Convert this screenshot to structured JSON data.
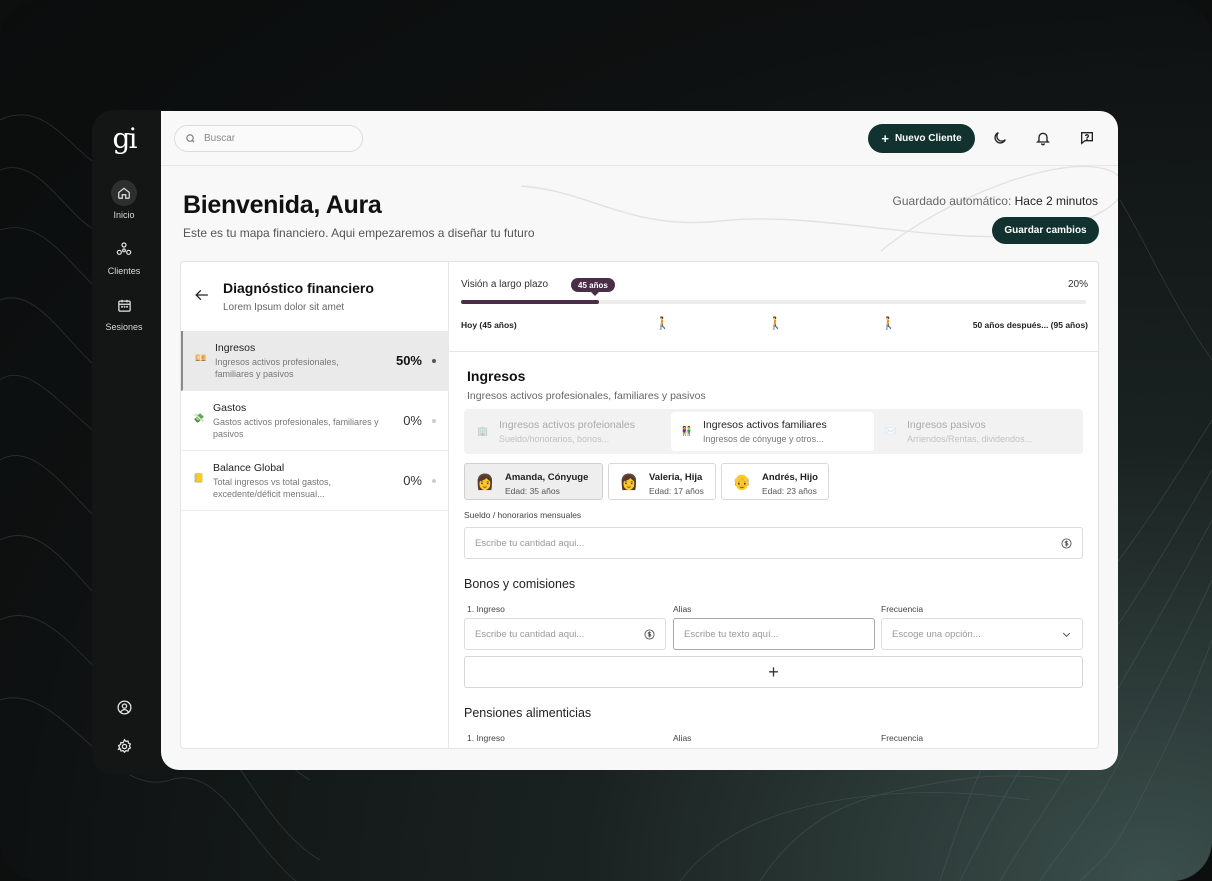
{
  "sidebar": {
    "logo": "gi",
    "items": [
      {
        "label": "Inicio",
        "icon": "home-icon"
      },
      {
        "label": "Clientes",
        "icon": "clients-icon"
      },
      {
        "label": "Sesiones",
        "icon": "calendar-icon"
      }
    ],
    "bottom_icons": [
      "user-circle-icon",
      "gear-icon"
    ]
  },
  "topbar": {
    "search_placeholder": "Buscar",
    "new_client": "Nuevo Cliente",
    "icons": [
      "moon-icon",
      "bell-icon",
      "help-chat-icon"
    ]
  },
  "header": {
    "title": "Bienvenida, Aura",
    "subtitle": "Este es tu mapa financiero. Aqui empezaremos a diseñar tu futuro",
    "autosave_label": "Guardado automático:",
    "autosave_value": "Hace 2 minutos",
    "save_button": "Guardar cambios"
  },
  "diagnostic": {
    "title": "Diagnóstico financiero",
    "subtitle": "Lorem Ipsum dolor sit amet",
    "categories": [
      {
        "name": "Ingresos",
        "desc": "Ingresos activos profesionales, familiares y pasivos",
        "pct": "50%",
        "icon": "money-icon"
      },
      {
        "name": "Gastos",
        "desc": "Gastos activos profesionales, familiares y pasivos",
        "pct": "0%",
        "icon": "money-wings-icon"
      },
      {
        "name": "Balance Global",
        "desc": "Total ingresos vs total gastos, excedente/déficit mensual...",
        "pct": "0%",
        "icon": "balance-icon"
      }
    ]
  },
  "timeline": {
    "label": "Visión a largo plazo",
    "badge": "45 años",
    "percent": "20%",
    "progress": 0.22,
    "start": "Hoy (45 años)",
    "end": "50 años después... (95 años)",
    "walker_icon": "walking-person-icon"
  },
  "incomes": {
    "title": "Ingresos",
    "subtitle": "Ingresos activos profesionales, familiares y pasivos",
    "tabs": [
      {
        "name": "Ingresos activos profeionales",
        "sub": "Sueldo/honorarios, bonos...",
        "icon": "office-icon"
      },
      {
        "name": "Ingresos activos familiares",
        "sub": "Ingresos de cónyuge y otros...",
        "icon": "family-icon"
      },
      {
        "name": "Ingresos pasivos",
        "sub": "Arriendos/Rentas, dividendos...",
        "icon": "envelope-icon"
      }
    ],
    "people": [
      {
        "name": "Amanda, Cónyuge",
        "age": "Edad: 35 años",
        "avatar": "👩"
      },
      {
        "name": "Valeria, Hija",
        "age": "Edad: 17 años",
        "avatar": "👩"
      },
      {
        "name": "Andrés, Hijo",
        "age": "Edad: 23 años",
        "avatar": "👴"
      }
    ],
    "salary_label": "Sueldo / honorarios mensuales",
    "salary_placeholder": "Escribe tu cantidad aqui...",
    "bonus_title": "Bonos y comisiones",
    "bonus_fields": {
      "income_label": "1. Ingreso",
      "income_placeholder": "Escribe tu cantidad aqui...",
      "alias_label": "Alias",
      "alias_placeholder": "Escribe tu texto aquí...",
      "freq_label": "Frecuencia",
      "freq_placeholder": "Escoge una opción..."
    },
    "add_symbol": "+",
    "pension_title": "Pensiones alimenticias",
    "pension_fields": {
      "income_label": "1. Ingreso",
      "alias_label": "Alias",
      "freq_label": "Frecuencia"
    }
  },
  "colors": {
    "primary": "#12322f",
    "accent": "#4a2e47"
  }
}
